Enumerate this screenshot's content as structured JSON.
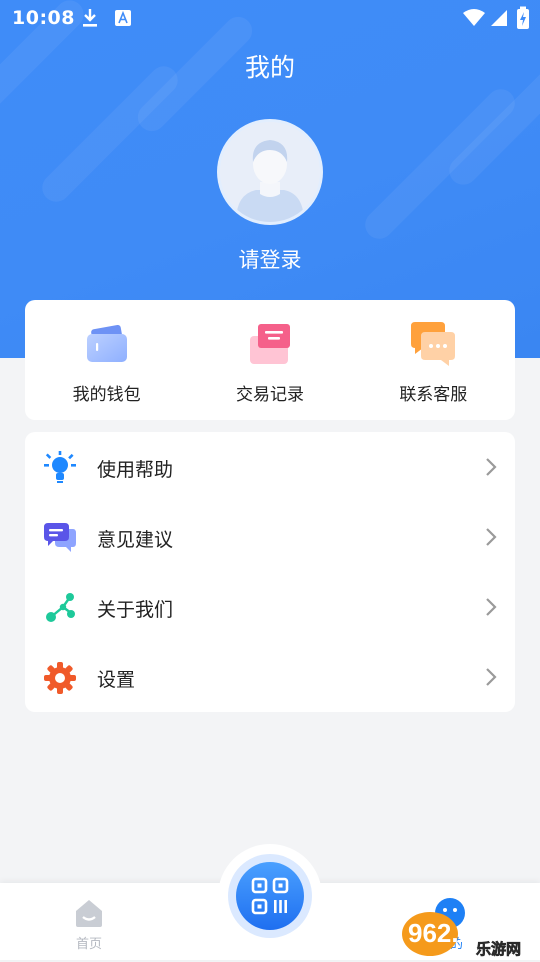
{
  "status_bar": {
    "time": "10:08"
  },
  "header": {
    "title": "我的"
  },
  "profile": {
    "login_text": "请登录"
  },
  "quick_actions": [
    {
      "label": "我的钱包",
      "icon": "wallet-icon"
    },
    {
      "label": "交易记录",
      "icon": "transaction-record-icon"
    },
    {
      "label": "联系客服",
      "icon": "customer-service-icon"
    }
  ],
  "menu": [
    {
      "label": "使用帮助",
      "icon": "lightbulb-icon"
    },
    {
      "label": "意见建议",
      "icon": "chat-feedback-icon"
    },
    {
      "label": "关于我们",
      "icon": "share-nodes-icon"
    },
    {
      "label": "设置",
      "icon": "gear-icon"
    }
  ],
  "bottom_nav": {
    "home_label": "首页",
    "mine_label": "我的",
    "center_action": "qr-scan-icon"
  },
  "watermark": {
    "brand": "962.NET",
    "site": "乐游网"
  },
  "colors": {
    "primary": "#3f8cf8",
    "background": "#f3f4f6",
    "card": "#ffffff",
    "text": "#222222",
    "muted": "#b5b9c1"
  }
}
